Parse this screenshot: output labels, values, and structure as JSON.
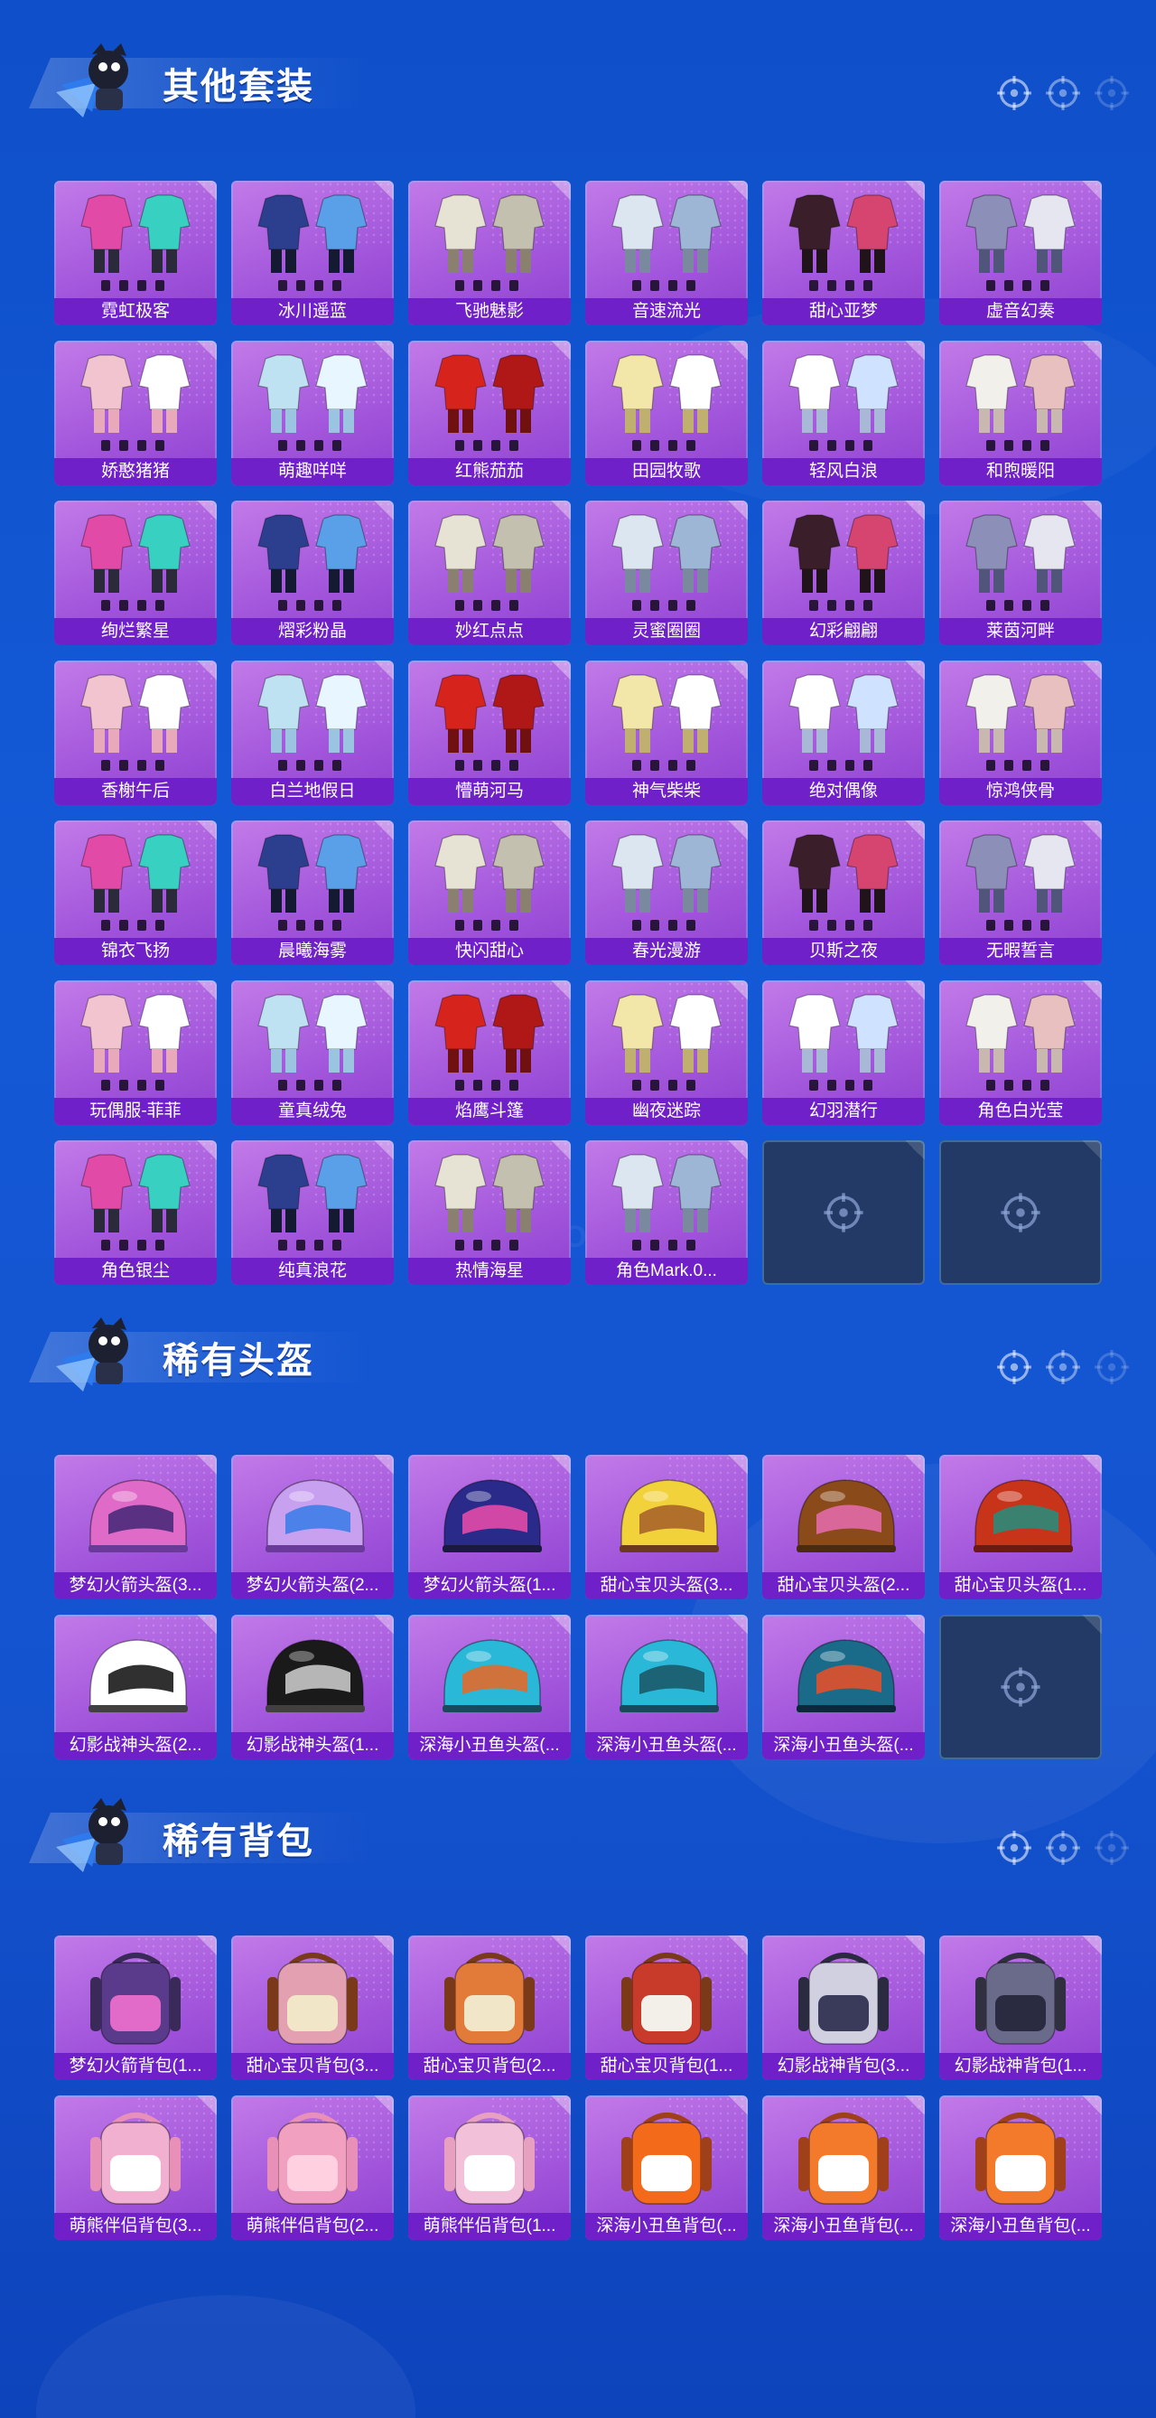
{
  "colors": {
    "background": "#1359d6",
    "card": "#a458dc",
    "card_label_bar": "#7020c8",
    "empty_slot": "#233a66"
  },
  "watermark": "GAME FOR PEACE",
  "sections": [
    {
      "title": "其他套装",
      "item_kind": "outfit",
      "items": [
        "霓虹极客",
        "冰川遥蓝",
        "飞驰魅影",
        "音速流光",
        "甜心亚梦",
        "虚音幻奏",
        "娇憨猪猪",
        "萌趣咩咩",
        "红熊茄茄",
        "田园牧歌",
        "轻风白浪",
        "和煦暖阳",
        "绚烂繁星",
        "熠彩粉晶",
        "妙红点点",
        "灵蜜圈圈",
        "幻彩翩翩",
        "莱茵河畔",
        "香榭午后",
        "白兰地假日",
        "懵萌河马",
        "神气柴柴",
        "绝对偶像",
        "惊鸿侠骨",
        "锦衣飞扬",
        "晨曦海雾",
        "快闪甜心",
        "春光漫游",
        "贝斯之夜",
        "无暇誓言",
        "玩偶服-菲菲",
        "童真绒兔",
        "焰鹰斗篷",
        "幽夜迷踪",
        "幻羽潜行",
        "角色白光莹",
        "角色银尘",
        "纯真浪花",
        "热情海星",
        "角色Mark.0..."
      ],
      "empty_slots": 2
    },
    {
      "title": "稀有头盔",
      "item_kind": "helmet",
      "items": [
        "梦幻火箭头盔(3...",
        "梦幻火箭头盔(2...",
        "梦幻火箭头盔(1...",
        "甜心宝贝头盔(3...",
        "甜心宝贝头盔(2...",
        "甜心宝贝头盔(1...",
        "幻影战神头盔(2...",
        "幻影战神头盔(1...",
        "深海小丑鱼头盔(...",
        "深海小丑鱼头盔(...",
        "深海小丑鱼头盔(..."
      ],
      "empty_slots": 1
    },
    {
      "title": "稀有背包",
      "item_kind": "backpack",
      "items": [
        "梦幻火箭背包(1...",
        "甜心宝贝背包(3...",
        "甜心宝贝背包(2...",
        "甜心宝贝背包(1...",
        "幻影战神背包(3...",
        "幻影战神背包(1...",
        "萌熊伴侣背包(3...",
        "萌熊伴侣背包(2...",
        "萌熊伴侣背包(1...",
        "深海小丑鱼背包(...",
        "深海小丑鱼背包(...",
        "深海小丑鱼背包(..."
      ],
      "empty_slots": 0
    }
  ]
}
